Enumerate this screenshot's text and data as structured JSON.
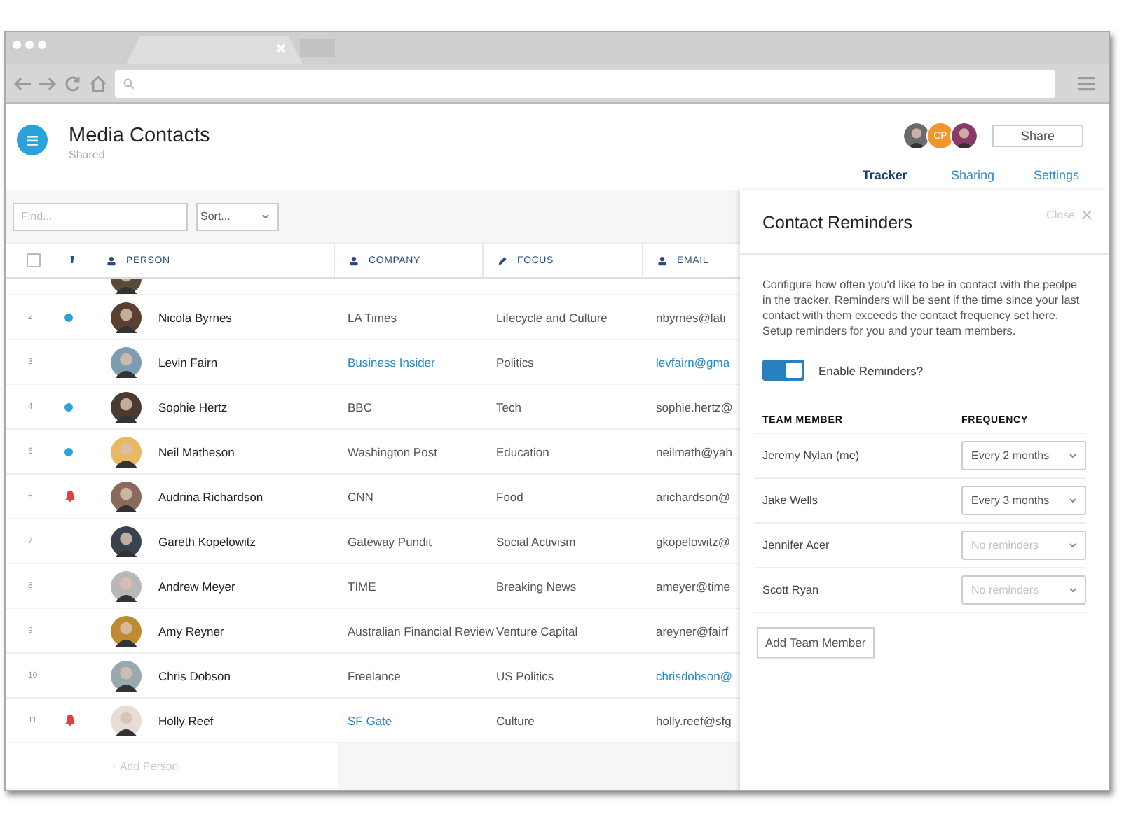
{
  "app": {
    "title": "Media Contacts",
    "subtitle": "Shared",
    "share_button": "Share",
    "collaborators": [
      {
        "kind": "photo"
      },
      {
        "kind": "initials",
        "initials": "CP"
      },
      {
        "kind": "photo"
      }
    ],
    "tabs": [
      {
        "label": "Tracker",
        "selected": true
      },
      {
        "label": "Sharing",
        "selected": false
      },
      {
        "label": "Settings",
        "selected": false
      }
    ]
  },
  "toolbar": {
    "search": {
      "placeholder": "Find..."
    },
    "sort": {
      "value": "Sort..."
    }
  },
  "table": {
    "select_all": {
      "checked": false
    },
    "columns": [
      {
        "label": "PERSON"
      },
      {
        "label": "COMPANY"
      },
      {
        "label": "FOCUS"
      },
      {
        "label": "EMAIL"
      }
    ],
    "rows": [
      {
        "number": "2",
        "kind": "dot",
        "name": "Nicola Byrnes",
        "company": "LA Times",
        "company_link": false,
        "focus": "Lifecycle and Culture",
        "email": "nbyrnes@lati",
        "email_link": false
      },
      {
        "number": "3",
        "kind": "plain",
        "name": "Levin Fairn",
        "company": "Business Insider",
        "company_link": true,
        "focus": "Politics",
        "email": "levfairn@gma",
        "email_link": true
      },
      {
        "number": "4",
        "kind": "dot",
        "name": "Sophie Hertz",
        "company": "BBC",
        "company_link": false,
        "focus": "Tech",
        "email": "sophie.hertz@",
        "email_link": false
      },
      {
        "number": "5",
        "kind": "dot",
        "name": "Neil Matheson",
        "company": "Washington Post",
        "company_link": false,
        "focus": "Education",
        "email": "neilmath@yah",
        "email_link": false
      },
      {
        "number": "6",
        "kind": "bell",
        "name": "Audrina Richardson",
        "company": "CNN",
        "company_link": false,
        "focus": "Food",
        "email": "arichardson@",
        "email_link": false
      },
      {
        "number": "7",
        "kind": "plain",
        "name": "Gareth Kopelowitz",
        "company": "Gateway Pundit",
        "company_link": false,
        "focus": "Social Activism",
        "email": "gkopelowitz@",
        "email_link": false
      },
      {
        "number": "8",
        "kind": "plain",
        "name": "Andrew Meyer",
        "company": "TIME",
        "company_link": false,
        "focus": "Breaking News",
        "email": "ameyer@time",
        "email_link": false
      },
      {
        "number": "9",
        "kind": "plain",
        "name": "Amy Reyner",
        "company": "Australian Financial Review",
        "company_link": false,
        "focus": "Venture Capital",
        "email": "areyner@fairf",
        "email_link": false
      },
      {
        "number": "10",
        "kind": "plain",
        "name": "Chris Dobson",
        "company": "Freelance",
        "company_link": false,
        "focus": "US Politics",
        "email": "chrisdobson@",
        "email_link": true
      },
      {
        "number": "11",
        "kind": "bell",
        "name": "Holly Reef",
        "company": "SF Gate",
        "company_link": true,
        "focus": "Culture",
        "email": "holly.reef@sfg",
        "email_link": false
      }
    ],
    "add_label": "+ Add Person"
  },
  "panel": {
    "title": "Contact Reminders",
    "close_label": "Close",
    "description": "Configure how often you'd like to be in contact with the peolpe in the tracker. Reminders will be sent if the time since your last contact with them exceeds the contact frequency set here. Setup reminders for you and your team members.",
    "switch": {
      "label": "Enable Reminders?",
      "on": true
    },
    "columns": [
      "TEAM MEMBER",
      "FREQUENCY"
    ],
    "members": [
      {
        "name": "Jeremy Nylan (me)",
        "frequency": "Every 2 months",
        "is_placeholder": false
      },
      {
        "name": "Jake Wells",
        "frequency": "Every 3 months",
        "is_placeholder": false
      },
      {
        "name": "Jennifer Acer",
        "frequency": "No reminders",
        "is_placeholder": true
      },
      {
        "name": "Scott Ryan",
        "frequency": "No reminders",
        "is_placeholder": true
      }
    ],
    "add_button": "Add Team Member"
  }
}
